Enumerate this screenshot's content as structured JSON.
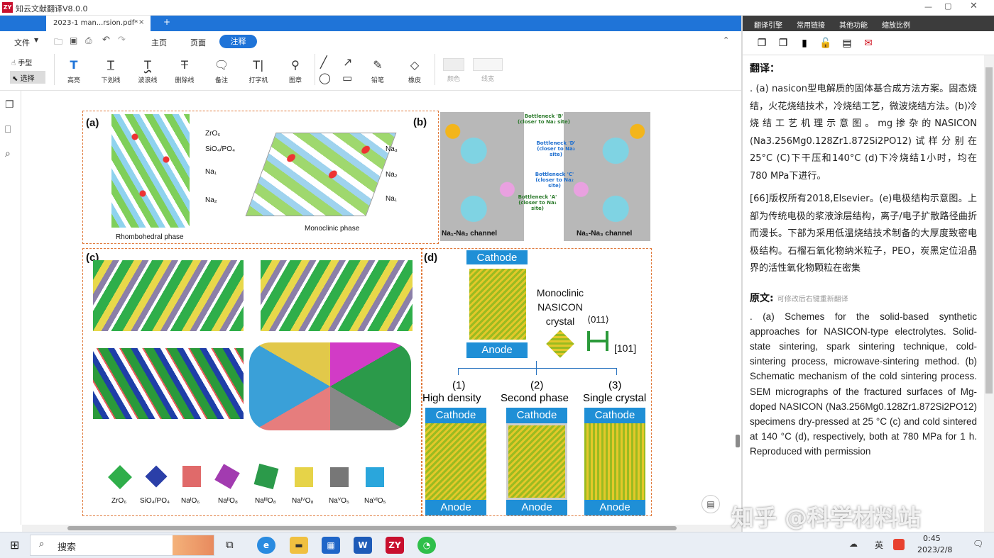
{
  "window": {
    "title": "知云文献翻译V8.0.0",
    "app_icon": "ZY"
  },
  "tabs": {
    "active_tab": "2023-1 man...rsion.pdf*",
    "close": "×",
    "add": "+"
  },
  "menu": {
    "file": "文件",
    "main_tabs": [
      "主页",
      "页面",
      "注释"
    ],
    "active_tab": "注释"
  },
  "tools": {
    "hand": "手型",
    "select": "选择",
    "annot": [
      "高亮",
      "下划线",
      "波浪线",
      "删除线",
      "备注",
      "打字机",
      "图章"
    ],
    "draw_pencil": "铅笔",
    "draw_eraser": "橡皮",
    "color": "颜色",
    "line_width": "线宽"
  },
  "figure": {
    "a": {
      "label": "(a)",
      "labels": [
        "ZrO₆",
        "SiO₄/PO₄",
        "Na₁",
        "Na₂"
      ],
      "phase1": "Rhombohedral phase",
      "labels2": [
        "Na₃",
        "Na₂",
        "Na₁"
      ],
      "phase2": "Monoclinic phase"
    },
    "b": {
      "label": "(b)",
      "bottlenecks": [
        "Bottleneck 'B' (closer to Na₂ site)",
        "Bottleneck 'D' (closer to Na₃ site)",
        "Bottleneck 'C' (closer to Na₂ site)",
        "Bottleneck 'A' (closer to Na₁ site)"
      ],
      "channel1": "Na₁-Na₂ channel",
      "channel2": "Na₁-Na₃ channel"
    },
    "c": {
      "label": "(c)",
      "legend": [
        "ZrO₆",
        "SiO₄/PO₄",
        "NaᴵO₆",
        "NaᴵᴵO₈",
        "NaᴵᴵᴵO₈",
        "NaᴵⱽO₈",
        "NaⱽO₅",
        "NaⱽᴵO₅"
      ]
    },
    "d": {
      "label": "(d)",
      "cathode": "Cathode",
      "anode": "Anode",
      "crystal": "Monoclinic NASICON crystal",
      "dir1": "⟨011⟩",
      "dir2": "[101]",
      "options": [
        {
          "n": "(1)",
          "t": "High density"
        },
        {
          "n": "(2)",
          "t": "Second phase"
        },
        {
          "n": "(3)",
          "t": "Single crystal"
        }
      ]
    }
  },
  "translation": {
    "menu": [
      "翻译引擎",
      "常用链接",
      "其他功能",
      "缩放比例"
    ],
    "header": "翻译：",
    "para1": ". (a) nasicon型电解质的固体基合成方法方案。固态烧结，火花烧结技术，冷烧结工艺，微波烧结方法。(b)冷烧结工艺机理示意图。mg掺杂的NASICON (Na3.256Mg0.128Zr1.872Si2PO12)试样分别在25°C (C)下干压和140°C (d)下冷烧结1小时，均在780 MPa下进行。",
    "para2": "[66]版权所有2018,Elsevier。(e)电极结构示意图。上部为传统电极的浆液涂层结构，离子/电子扩散路径曲折而漫长。下部为采用低温烧结技术制备的大厚度致密电极结构。石榴石氧化物纳米粒子，PEO，炭黑定位沿晶界的活性氧化物颗粒在密集",
    "orig_header": "原文:",
    "orig_hint": "可修改后右键重新翻译",
    "original": ". (a) Schemes for the solid-based synthetic approaches for NASICON-type electrolytes. Solid-state sintering, spark sintering technique, cold-sintering process, microwave-sintering method. (b) Schematic mechanism of the cold sintering process. SEM micrographs of the fractured surfaces of Mg-doped NASICON (Na3.256Mg0.128Zr1.872Si2PO12) specimens dry-pressed at 25 °C (c) and cold sintered at 140 °C (d), respectively, both at 780 MPa for 1 h. Reproduced with permission"
  },
  "taskbar": {
    "search": "搜索",
    "time": "0:45",
    "date": "2023/2/8",
    "ime": "英"
  },
  "watermark": "知乎 @科学材料站"
}
